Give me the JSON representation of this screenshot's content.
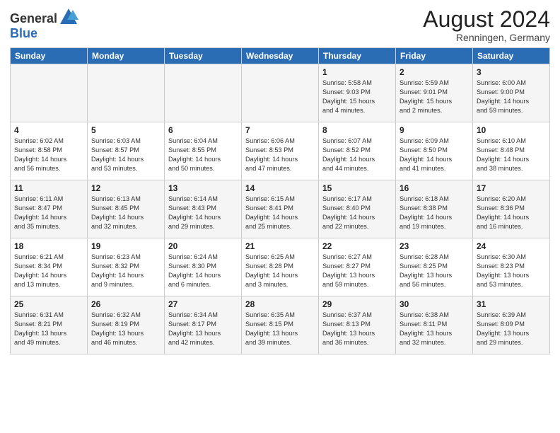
{
  "header": {
    "logo_general": "General",
    "logo_blue": "Blue",
    "month_year": "August 2024",
    "location": "Renningen, Germany"
  },
  "days_of_week": [
    "Sunday",
    "Monday",
    "Tuesday",
    "Wednesday",
    "Thursday",
    "Friday",
    "Saturday"
  ],
  "weeks": [
    [
      {
        "day": "",
        "info": ""
      },
      {
        "day": "",
        "info": ""
      },
      {
        "day": "",
        "info": ""
      },
      {
        "day": "",
        "info": ""
      },
      {
        "day": "1",
        "info": "Sunrise: 5:58 AM\nSunset: 9:03 PM\nDaylight: 15 hours\nand 4 minutes."
      },
      {
        "day": "2",
        "info": "Sunrise: 5:59 AM\nSunset: 9:01 PM\nDaylight: 15 hours\nand 2 minutes."
      },
      {
        "day": "3",
        "info": "Sunrise: 6:00 AM\nSunset: 9:00 PM\nDaylight: 14 hours\nand 59 minutes."
      }
    ],
    [
      {
        "day": "4",
        "info": "Sunrise: 6:02 AM\nSunset: 8:58 PM\nDaylight: 14 hours\nand 56 minutes."
      },
      {
        "day": "5",
        "info": "Sunrise: 6:03 AM\nSunset: 8:57 PM\nDaylight: 14 hours\nand 53 minutes."
      },
      {
        "day": "6",
        "info": "Sunrise: 6:04 AM\nSunset: 8:55 PM\nDaylight: 14 hours\nand 50 minutes."
      },
      {
        "day": "7",
        "info": "Sunrise: 6:06 AM\nSunset: 8:53 PM\nDaylight: 14 hours\nand 47 minutes."
      },
      {
        "day": "8",
        "info": "Sunrise: 6:07 AM\nSunset: 8:52 PM\nDaylight: 14 hours\nand 44 minutes."
      },
      {
        "day": "9",
        "info": "Sunrise: 6:09 AM\nSunset: 8:50 PM\nDaylight: 14 hours\nand 41 minutes."
      },
      {
        "day": "10",
        "info": "Sunrise: 6:10 AM\nSunset: 8:48 PM\nDaylight: 14 hours\nand 38 minutes."
      }
    ],
    [
      {
        "day": "11",
        "info": "Sunrise: 6:11 AM\nSunset: 8:47 PM\nDaylight: 14 hours\nand 35 minutes."
      },
      {
        "day": "12",
        "info": "Sunrise: 6:13 AM\nSunset: 8:45 PM\nDaylight: 14 hours\nand 32 minutes."
      },
      {
        "day": "13",
        "info": "Sunrise: 6:14 AM\nSunset: 8:43 PM\nDaylight: 14 hours\nand 29 minutes."
      },
      {
        "day": "14",
        "info": "Sunrise: 6:15 AM\nSunset: 8:41 PM\nDaylight: 14 hours\nand 25 minutes."
      },
      {
        "day": "15",
        "info": "Sunrise: 6:17 AM\nSunset: 8:40 PM\nDaylight: 14 hours\nand 22 minutes."
      },
      {
        "day": "16",
        "info": "Sunrise: 6:18 AM\nSunset: 8:38 PM\nDaylight: 14 hours\nand 19 minutes."
      },
      {
        "day": "17",
        "info": "Sunrise: 6:20 AM\nSunset: 8:36 PM\nDaylight: 14 hours\nand 16 minutes."
      }
    ],
    [
      {
        "day": "18",
        "info": "Sunrise: 6:21 AM\nSunset: 8:34 PM\nDaylight: 14 hours\nand 13 minutes."
      },
      {
        "day": "19",
        "info": "Sunrise: 6:23 AM\nSunset: 8:32 PM\nDaylight: 14 hours\nand 9 minutes."
      },
      {
        "day": "20",
        "info": "Sunrise: 6:24 AM\nSunset: 8:30 PM\nDaylight: 14 hours\nand 6 minutes."
      },
      {
        "day": "21",
        "info": "Sunrise: 6:25 AM\nSunset: 8:28 PM\nDaylight: 14 hours\nand 3 minutes."
      },
      {
        "day": "22",
        "info": "Sunrise: 6:27 AM\nSunset: 8:27 PM\nDaylight: 13 hours\nand 59 minutes."
      },
      {
        "day": "23",
        "info": "Sunrise: 6:28 AM\nSunset: 8:25 PM\nDaylight: 13 hours\nand 56 minutes."
      },
      {
        "day": "24",
        "info": "Sunrise: 6:30 AM\nSunset: 8:23 PM\nDaylight: 13 hours\nand 53 minutes."
      }
    ],
    [
      {
        "day": "25",
        "info": "Sunrise: 6:31 AM\nSunset: 8:21 PM\nDaylight: 13 hours\nand 49 minutes."
      },
      {
        "day": "26",
        "info": "Sunrise: 6:32 AM\nSunset: 8:19 PM\nDaylight: 13 hours\nand 46 minutes."
      },
      {
        "day": "27",
        "info": "Sunrise: 6:34 AM\nSunset: 8:17 PM\nDaylight: 13 hours\nand 42 minutes."
      },
      {
        "day": "28",
        "info": "Sunrise: 6:35 AM\nSunset: 8:15 PM\nDaylight: 13 hours\nand 39 minutes."
      },
      {
        "day": "29",
        "info": "Sunrise: 6:37 AM\nSunset: 8:13 PM\nDaylight: 13 hours\nand 36 minutes."
      },
      {
        "day": "30",
        "info": "Sunrise: 6:38 AM\nSunset: 8:11 PM\nDaylight: 13 hours\nand 32 minutes."
      },
      {
        "day": "31",
        "info": "Sunrise: 6:39 AM\nSunset: 8:09 PM\nDaylight: 13 hours\nand 29 minutes."
      }
    ]
  ]
}
